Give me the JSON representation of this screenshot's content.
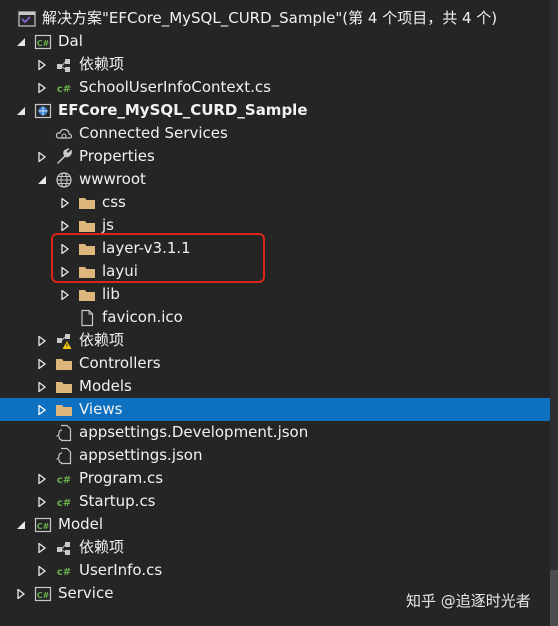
{
  "solution": {
    "label": "解决方案\"EFCore_MySQL_CURD_Sample\"(第 4 个项目，共 4 个)"
  },
  "dal": {
    "label": "Dal",
    "deps_label": "依赖项",
    "context_file": "SchoolUserInfoContext.cs"
  },
  "web": {
    "label": "EFCore_MySQL_CURD_Sample",
    "connected_services": "Connected Services",
    "properties": "Properties",
    "wwwroot": "wwwroot",
    "css": "css",
    "js": "js",
    "layer": "layer-v3.1.1",
    "layui": "layui",
    "lib": "lib",
    "favicon": "favicon.ico",
    "deps_label": "依赖项",
    "controllers": "Controllers",
    "models": "Models",
    "views": "Views",
    "appsettings_dev": "appsettings.Development.json",
    "appsettings": "appsettings.json",
    "program": "Program.cs",
    "startup": "Startup.cs"
  },
  "model": {
    "label": "Model",
    "deps_label": "依赖项",
    "userinfo": "UserInfo.cs"
  },
  "service": {
    "label": "Service"
  },
  "watermark": "知乎 @追逐时光者",
  "colors": {
    "background": "#252526",
    "selection": "#0e70c0",
    "folder": "#dcb67a",
    "highlight_border": "#d9261c",
    "csharp_green": "#6ab04c",
    "vs_purple": "#865fc5"
  },
  "selected_item": "Views",
  "highlighted_items": [
    "layer-v3.1.1",
    "layui"
  ]
}
